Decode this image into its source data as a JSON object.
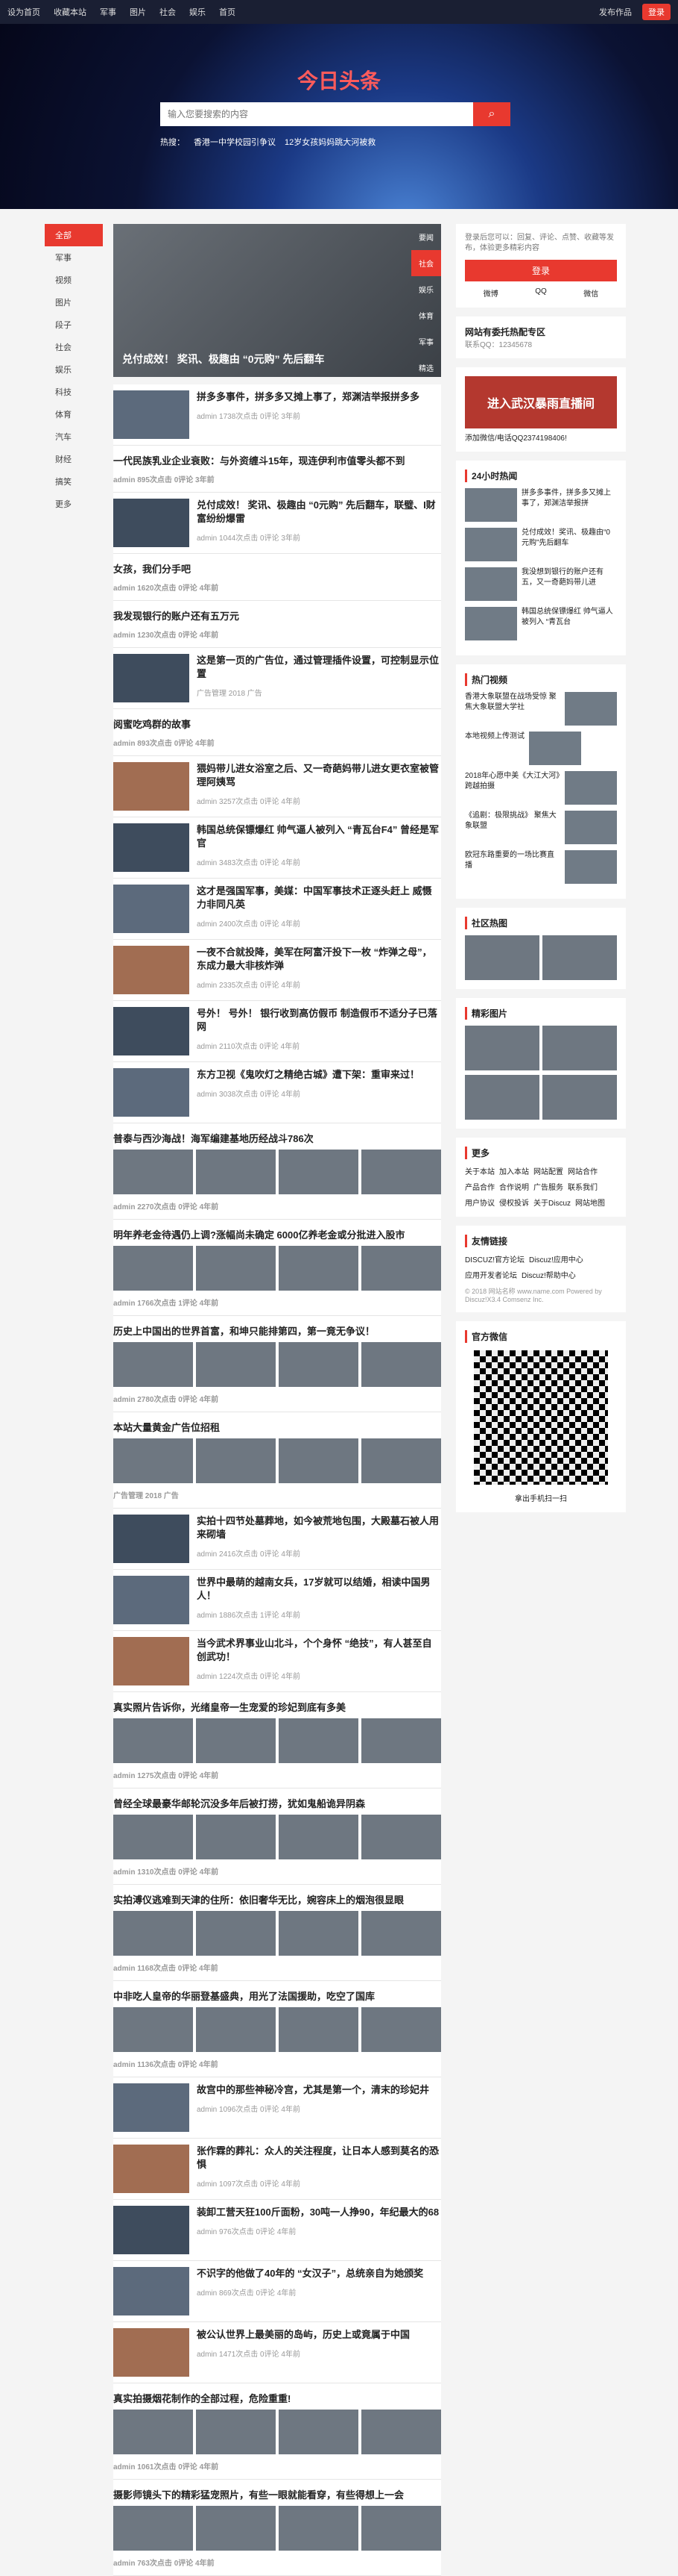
{
  "topbar": {
    "links": [
      "设为首页",
      "收藏本站",
      "军事",
      "图片",
      "社会",
      "娱乐",
      "首页"
    ],
    "post": "发布作品",
    "login": "登录"
  },
  "hero": {
    "title": "今日头条",
    "search_placeholder": "输入您要搜索的内容",
    "hot_label": "热搜：",
    "hot": [
      "香港一中学校园引争议",
      "12岁女孩妈妈跳大河被救"
    ]
  },
  "leftnav": [
    "全部",
    "军事",
    "视频",
    "图片",
    "段子",
    "社会",
    "娱乐",
    "科技",
    "体育",
    "汽车",
    "财经",
    "搞笑",
    "更多"
  ],
  "slider": {
    "caption": "兑付成效！ 奖讯、极趣由 “0元购” 先后翻车",
    "tabs": [
      "要闻",
      "社会",
      "娱乐",
      "体育",
      "军事",
      "精选"
    ]
  },
  "articles": [
    {
      "title": "拼多多事件，拼多多又摊上事了，郑渊洁举报拼多多",
      "meta": "admin 1738次点击 0评论 3年前"
    },
    {
      "title": "一代民族乳业企业衰败：与外资缠斗15年，现连伊利市值零头都不到",
      "meta": "admin 895次点击 0评论 3年前",
      "plain": true
    },
    {
      "title": "兑付成效！ 奖讯、极趣由 “0元购” 先后翻车，联璧、I财富纷纷爆雷",
      "meta": "admin 1044次点击 0评论 3年前"
    },
    {
      "title": "女孩，我们分手吧",
      "meta": "admin 1620次点击 0评论 4年前",
      "plain": true
    },
    {
      "title": "我发现银行的账户还有五万元",
      "meta": "admin 1230次点击 0评论 4年前",
      "plain": true
    },
    {
      "title": "这是第一页的广告位，通过管理插件设置，可控制显示位置",
      "meta": "广告管理 2018 广告"
    },
    {
      "title": "阅蜜吃鸡群的故事",
      "meta": "admin 893次点击 0评论 4年前",
      "plain": true
    },
    {
      "title": "猥妈带儿进女浴室之后、又一奇葩妈带儿进女更衣室被管理阿姨骂",
      "meta": "admin 3257次点击 0评论 4年前"
    },
    {
      "title": "韩国总统保镖爆红 帅气逼人被列入 “青瓦台F4” 曾经是军官",
      "meta": "admin 3483次点击 0评论 4年前"
    },
    {
      "title": "这才是强国军事，美媒：中国军事技术正逐头赶上 威慑力非同凡英",
      "meta": "admin 2400次点击 0评论 4年前"
    },
    {
      "title": "一夜不合就投降，美军在阿富汗投下一枚 “炸弹之母”，东成力最大非核炸弹",
      "meta": "admin 2335次点击 0评论 4年前"
    },
    {
      "title": "号外！ 号外！ 银行收到高仿假币 制造假币不适分子已落网",
      "meta": "admin 2110次点击 0评论 4年前"
    },
    {
      "title": "东方卫视《鬼吹灯之精绝古城》遭下架：重审来过！",
      "meta": "admin 3038次点击 0评论 4年前"
    },
    {
      "title": "普泰与西沙海战！海军编建基地历经战斗786次",
      "meta": "admin 2270次点击 0评论 4年前",
      "grid": true
    },
    {
      "title": "明年养老金待遇仍上调?涨幅尚未确定 6000亿养老金或分批进入股市",
      "meta": "admin 1766次点击 1评论 4年前",
      "grid": true
    },
    {
      "title": "历史上中国出的世界首富，和坤只能排第四，第一竟无争议！",
      "meta": "admin 2780次点击 0评论 4年前",
      "grid": true
    },
    {
      "title": "本站大量黄金广告位招租",
      "meta": "广告管理 2018 广告",
      "grid": true
    },
    {
      "title": "实拍十四节处墓葬地，如今被荒地包围，大殿墓石被人用来砌墙",
      "meta": "admin 2416次点击 0评论 4年前"
    },
    {
      "title": "世界中最萌的越南女兵，17岁就可以结婚，相读中国男人！",
      "meta": "admin 1886次点击 1评论 4年前"
    },
    {
      "title": "当今武术界事业山北斗，个个身怀 “绝技”，有人甚至自创武功！",
      "meta": "admin 1224次点击 0评论 4年前"
    },
    {
      "title": "真实照片告诉你，光绪皇帝一生宠爱的珍妃到底有多美",
      "meta": "admin 1275次点击 0评论 4年前",
      "grid": true
    },
    {
      "title": "曾经全球最豪华邮轮沉没多年后被打捞，犹如鬼船诡异阴森",
      "meta": "admin 1310次点击 0评论 4年前",
      "grid": true
    },
    {
      "title": "实拍溥仪逃难到天津的住所：依旧奢华无比，婉容床上的烟泡很显眼",
      "meta": "admin 1168次点击 0评论 4年前",
      "grid": true
    },
    {
      "title": "中非吃人皇帝的华丽登基盛典，用光了法国援助，吃空了国库",
      "meta": "admin 1136次点击 0评论 4年前",
      "grid": true
    },
    {
      "title": "故宫中的那些神秘冷宫，尤其是第一个，清末的珍妃井",
      "meta": "admin 1096次点击 0评论 4年前"
    },
    {
      "title": "张作霖的葬礼：众人的关注程度，让日本人感到莫名的恐惧",
      "meta": "admin 1097次点击 0评论 4年前"
    },
    {
      "title": "装卸工营天狂100斤面粉，30吨一人挣90，年纪最大的68",
      "meta": "admin 976次点击 0评论 4年前"
    },
    {
      "title": "不识字的他做了40年的 “女汉子”，总统亲自为她颁奖",
      "meta": "admin 869次点击 0评论 4年前"
    },
    {
      "title": "被公认世界上最美丽的岛屿，历史上或竟属于中国",
      "meta": "admin 1471次点击 0评论 4年前"
    },
    {
      "title": "真实拍摄烟花制作的全部过程，危险重重!",
      "meta": "admin 1061次点击 0评论 4年前",
      "grid": true
    },
    {
      "title": "摄影师镜头下的精彩猛宠照片，有些一眼就能看穿，有些得想上一会",
      "meta": "admin 763次点击 0评论 4年前",
      "grid": true
    }
  ],
  "sidebar": {
    "login_box": {
      "desc": "登录后您可以：回复、评论、点赞、收藏等发布，体验更多精彩内容",
      "login": "登录",
      "oauth": [
        "微博",
        "QQ",
        "微信"
      ]
    },
    "promo": {
      "title": "网站有委托热配专区",
      "sub": "联系QQ：12345678"
    },
    "ad_banner": {
      "text": "进入武汉暴雨直播间",
      "sub": "添加微信/电话QQ2374198406!"
    },
    "hot24_title": "24小时热闻",
    "hot24": [
      "拼多多事件，拼多多又摊上事了，郑渊洁举报拼",
      "兑付成效！奖讯、极趣由“0元购”先后翻车",
      "我没想到银行的账户还有五，又一奇葩妈带儿进",
      "韩国总统保镖爆红 帅气逼人被列入 “青瓦台"
    ],
    "video_title": "热门视频",
    "videos": [
      "香港大象联盟在战场受惊 聚焦大象联盟大学社",
      "本地视频上传测试",
      "2018年心愿中美《大江大河》跨越拍摄",
      "《追剧：极限挑战》 聚焦大象联盟",
      "欧冠东路重要的一场比赛直播"
    ],
    "community_title": "社区热图",
    "pics_title": "精彩图片",
    "more_title": "更多",
    "more_links": [
      "关于本站",
      "加入本站",
      "网站配置",
      "网站合作",
      "产品合作",
      "合作说明",
      "广告服务",
      "联系我们",
      "用户协议",
      "侵权投诉",
      "关于Discuz",
      "网站地图"
    ],
    "friend_title": "友情链接",
    "friends": [
      "DISCUZ!官方论坛",
      "Discuz!应用中心",
      "应用开发者论坛",
      "Discuz!帮助中心"
    ],
    "copyright": "© 2018 网站名称 www.name.com Powered by Discuz!X3.4 Comsenz Inc.",
    "qr_title": "官方微信",
    "qr_caption": "拿出手机扫一扫"
  }
}
